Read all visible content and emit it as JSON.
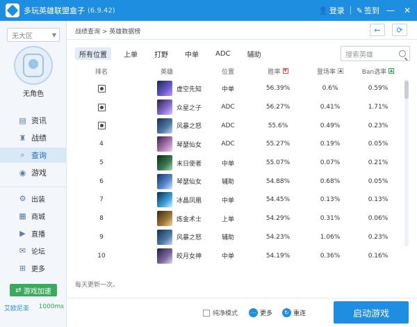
{
  "titlebar": {
    "title": "多玩英雄联盟盒子",
    "version": "(6.9.42)",
    "login": "登录",
    "signin": "签到",
    "minimize": "—",
    "close": "✕"
  },
  "sidebar": {
    "region": "无大区",
    "role_name": "无角色",
    "main_items": [
      {
        "label": "资讯",
        "icon": "doc-icon"
      },
      {
        "label": "战绩",
        "icon": "trophy-icon"
      },
      {
        "label": "查询",
        "icon": "search-icon"
      },
      {
        "label": "游戏",
        "icon": "gamepad-icon"
      }
    ],
    "sub_items": [
      {
        "label": "出装"
      },
      {
        "label": "商城"
      },
      {
        "label": "直播"
      },
      {
        "label": "论坛"
      },
      {
        "label": "更多"
      }
    ],
    "accel_label": "游戏加速",
    "server": "艾欧尼亚",
    "ping": "1000ms"
  },
  "main": {
    "breadcrumb": "战绩查询 > 英雄数据榜",
    "back_icon": "←",
    "refresh_icon": "⟳",
    "tabs": [
      "所有位置",
      "上单",
      "打野",
      "中单",
      "ADC",
      "辅助"
    ],
    "search_placeholder": "搜索英雄",
    "headers": {
      "rank": "排名",
      "hero": "英雄",
      "position": "位置",
      "winrate": "胜率",
      "pickrate": "登场率",
      "banrate": "Ban选率"
    },
    "rows": [
      {
        "rank": "",
        "hero": "虚空先知",
        "position": "中单",
        "win": "56.39%",
        "pick": "0.6%",
        "ban": "0.59%"
      },
      {
        "rank": "",
        "hero": "众星之子",
        "position": "ADC",
        "win": "56.27%",
        "pick": "0.41%",
        "ban": "1.71%"
      },
      {
        "rank": "",
        "hero": "风暴之怒",
        "position": "ADC",
        "win": "55.6%",
        "pick": "0.49%",
        "ban": "0.23%"
      },
      {
        "rank": "4",
        "hero": "琴瑟仙女",
        "position": "ADC",
        "win": "55.27%",
        "pick": "0.19%",
        "ban": "0.05%"
      },
      {
        "rank": "5",
        "hero": "末日使者",
        "position": "中单",
        "win": "55.07%",
        "pick": "0.07%",
        "ban": "0.21%"
      },
      {
        "rank": "6",
        "hero": "琴瑟仙女",
        "position": "辅助",
        "win": "54.88%",
        "pick": "0.68%",
        "ban": "0.05%"
      },
      {
        "rank": "7",
        "hero": "冰晶凤凰",
        "position": "中单",
        "win": "54.45%",
        "pick": "0.13%",
        "ban": "0.13%"
      },
      {
        "rank": "8",
        "hero": "炼金术士",
        "position": "上单",
        "win": "54.29%",
        "pick": "0.31%",
        "ban": "0.06%"
      },
      {
        "rank": "9",
        "hero": "风暴之怒",
        "position": "辅助",
        "win": "54.23%",
        "pick": "1.06%",
        "ban": "0.23%"
      },
      {
        "rank": "10",
        "hero": "皎月女神",
        "position": "中单",
        "win": "54.19%",
        "pick": "0.36%",
        "ban": "0.16%"
      }
    ],
    "update_note": "每天更新一次。"
  },
  "footer": {
    "clean_mode": "纯净模式",
    "more": "更多",
    "repair": "重连",
    "launch": "启动游戏"
  },
  "colors": {
    "accent": "#1e8ee0",
    "green": "#3aaa5c",
    "sort_red": "#e45050"
  }
}
